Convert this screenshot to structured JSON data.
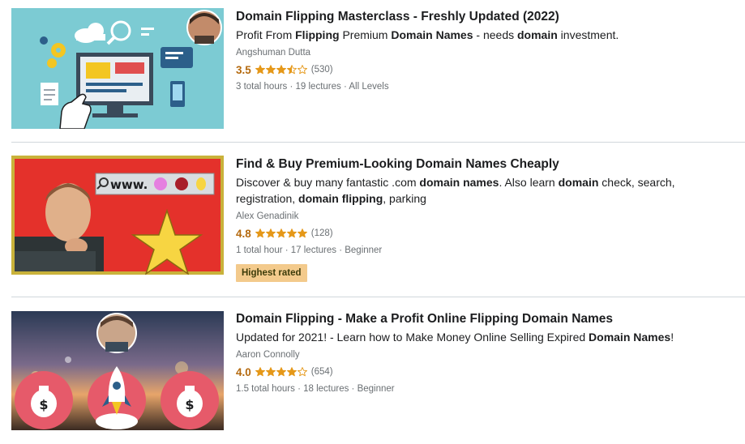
{
  "courses": [
    {
      "title": "Domain Flipping Masterclass - Freshly Updated (2022)",
      "headline": [
        {
          "t": "Profit From ",
          "b": false
        },
        {
          "t": "Flipping",
          "b": true
        },
        {
          "t": " Premium ",
          "b": false
        },
        {
          "t": "Domain Names",
          "b": true
        },
        {
          "t": " - needs ",
          "b": false
        },
        {
          "t": "domain",
          "b": true
        },
        {
          "t": " investment.",
          "b": false
        }
      ],
      "instructor": "Angshuman Dutta",
      "rating": "3.5",
      "rating_value": 3.5,
      "rating_count": "(530)",
      "meta": "3 total hours · 19 lectures · All Levels",
      "badge": ""
    },
    {
      "title": "Find & Buy Premium-Looking Domain Names Cheaply",
      "headline": [
        {
          "t": "Discover & buy many fantastic .com ",
          "b": false
        },
        {
          "t": "domain names",
          "b": true
        },
        {
          "t": ". Also learn ",
          "b": false
        },
        {
          "t": "domain",
          "b": true
        },
        {
          "t": " check, search, registration, ",
          "b": false
        },
        {
          "t": "domain flipping",
          "b": true
        },
        {
          "t": ", parking",
          "b": false
        }
      ],
      "instructor": "Alex Genadinik",
      "rating": "4.8",
      "rating_value": 4.8,
      "rating_count": "(128)",
      "meta": "1 total hour · 17 lectures · Beginner",
      "badge": "Highest rated",
      "thumb_text": "www."
    },
    {
      "title": "Domain Flipping - Make a Profit Online Flipping Domain Names",
      "headline": [
        {
          "t": "Updated for 2021! - Learn how to Make Money Online Selling Expired ",
          "b": false
        },
        {
          "t": "Domain Names",
          "b": true
        },
        {
          "t": "!",
          "b": false
        }
      ],
      "instructor": "Aaron Connolly",
      "rating": "4.0",
      "rating_value": 4.0,
      "rating_count": "(654)",
      "meta": "1.5 total hours · 18 lectures · Beginner",
      "badge": "",
      "thumb_text": "$"
    }
  ],
  "colors": {
    "rating": "#b4690e",
    "star": "#e59819",
    "badge_bg": "#f3ca8c",
    "divider": "#d1d7dc",
    "muted": "#6a6f73"
  }
}
